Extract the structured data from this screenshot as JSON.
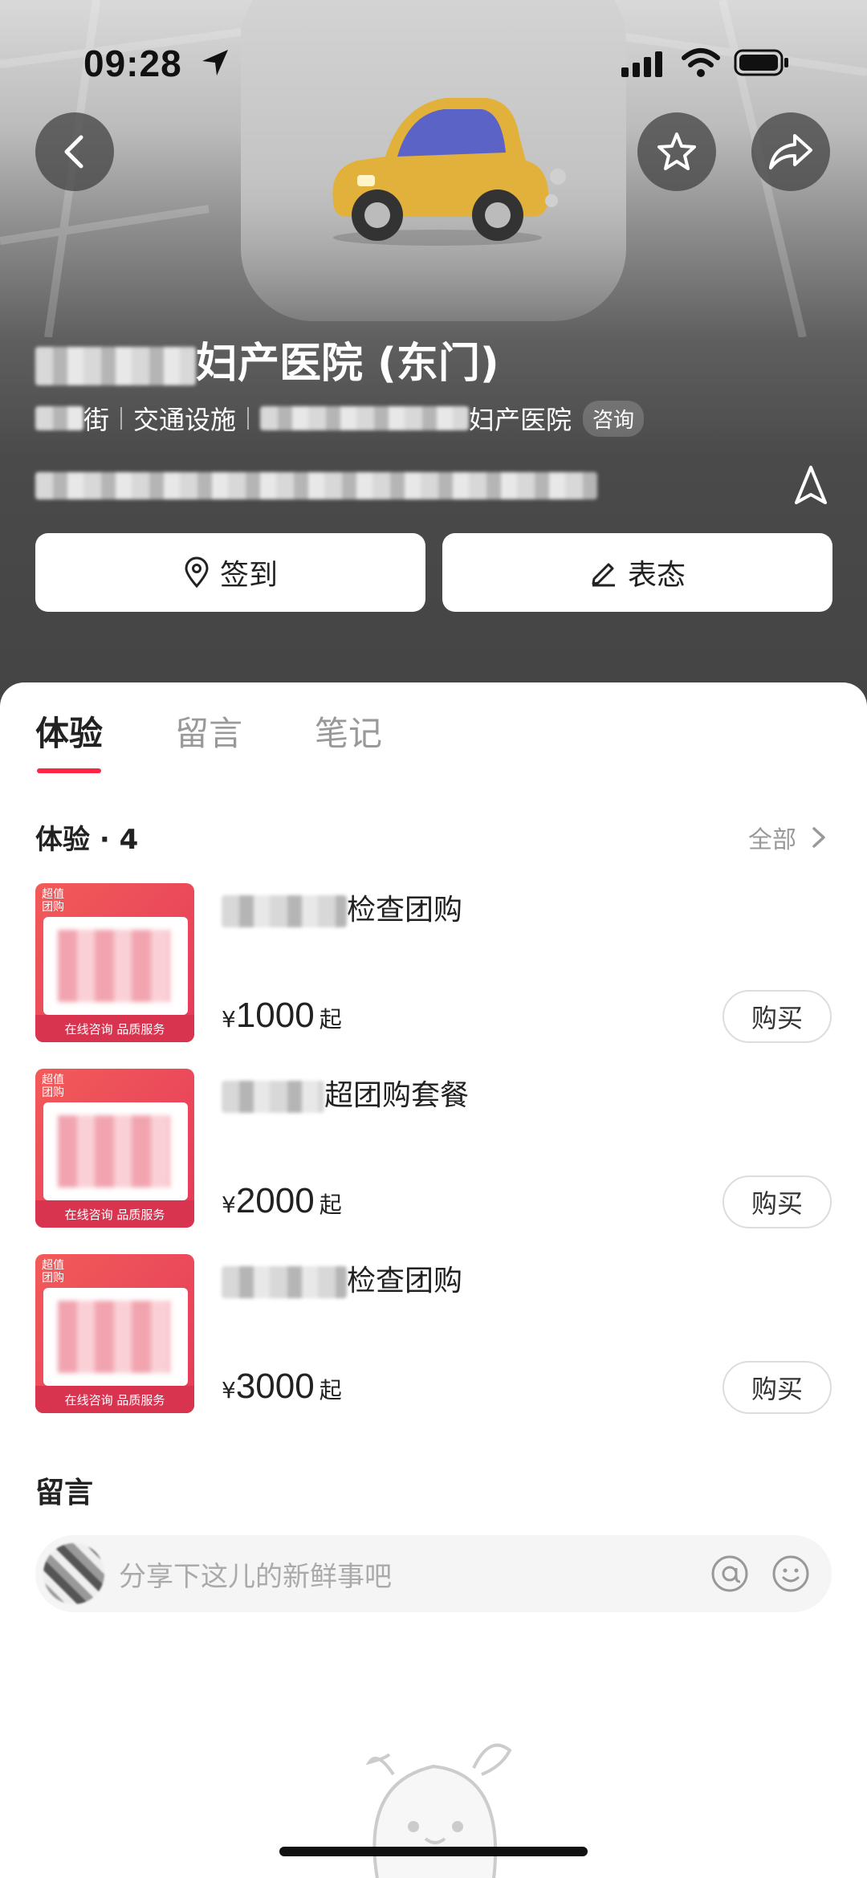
{
  "status_bar": {
    "time": "09:28"
  },
  "place": {
    "title_suffix": "妇产医院 (东门)",
    "meta": {
      "street_suffix": "街",
      "category": "交通设施",
      "related_suffix": "妇产医院",
      "consult": "咨询"
    }
  },
  "actions": {
    "checkin": "签到",
    "opinion": "表态"
  },
  "tabs": [
    {
      "label": "体验"
    },
    {
      "label": "留言"
    },
    {
      "label": "笔记"
    }
  ],
  "experience": {
    "title": "体验 · 4",
    "all_label": "全部",
    "thumb_tag": "超值团购",
    "thumb_footer": "在线咨询 品质服务",
    "items": [
      {
        "title_suffix": "检查团购",
        "currency": "¥",
        "price": "1000",
        "suffix": "起",
        "buy": "购买"
      },
      {
        "title_suffix": "超团购套餐",
        "currency": "¥",
        "price": "2000",
        "suffix": "起",
        "buy": "购买"
      },
      {
        "title_suffix": "检查团购",
        "currency": "¥",
        "price": "3000",
        "suffix": "起",
        "buy": "购买"
      }
    ]
  },
  "messages": {
    "title": "留言",
    "placeholder": "分享下这儿的新鲜事吧"
  },
  "colors": {
    "accent": "#ff2442",
    "thumb_red": "#e43a5a"
  }
}
